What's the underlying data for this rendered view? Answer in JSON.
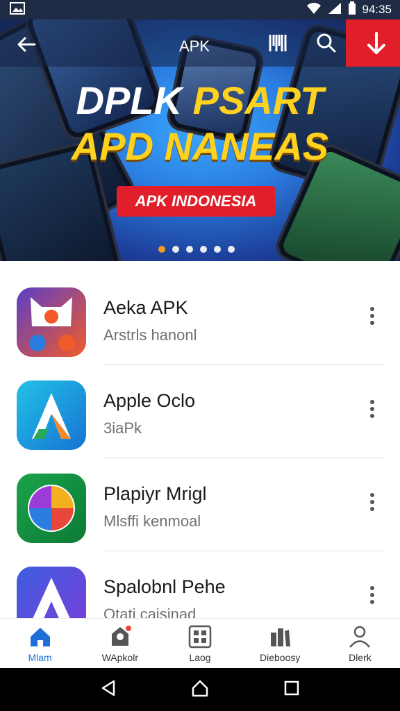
{
  "status_bar": {
    "time": "94:35"
  },
  "appbar": {
    "title": "APK"
  },
  "hero": {
    "headline_line1_a": "DPLK",
    "headline_line1_b": "PSART",
    "headline_line2": "APD NANEAS",
    "tag": "APK INDONESIA",
    "carousel": {
      "slides": 6,
      "active": 1
    }
  },
  "apps": [
    {
      "name": "Aeka APK",
      "subtitle": "Arstrls hanonl",
      "icon": "fox-icon"
    },
    {
      "name": "Apple Oclo",
      "subtitle": "3iaPk",
      "icon": "a-logo-icon"
    },
    {
      "name": "Plapiyr Mrigl",
      "subtitle": "Mlsffi kenmoal",
      "icon": "swirl-icon"
    },
    {
      "name": "Spalobnl Pehe",
      "subtitle": "Otati caisinad",
      "icon": "a-logo-icon"
    }
  ],
  "bottom_nav": [
    {
      "label": "Mlam",
      "icon": "home-icon",
      "active": true
    },
    {
      "label": "WApkolr",
      "icon": "store-icon",
      "active": false
    },
    {
      "label": "Laog",
      "icon": "grid-icon",
      "active": false
    },
    {
      "label": "Dieboosy",
      "icon": "library-icon",
      "active": false
    },
    {
      "label": "Dlerk",
      "icon": "person-icon",
      "active": false
    }
  ],
  "colors": {
    "accent": "#1e6fd6",
    "download": "#e01f2a",
    "hero_yellow": "#ffd21f",
    "status_bar": "#1f2a44"
  }
}
